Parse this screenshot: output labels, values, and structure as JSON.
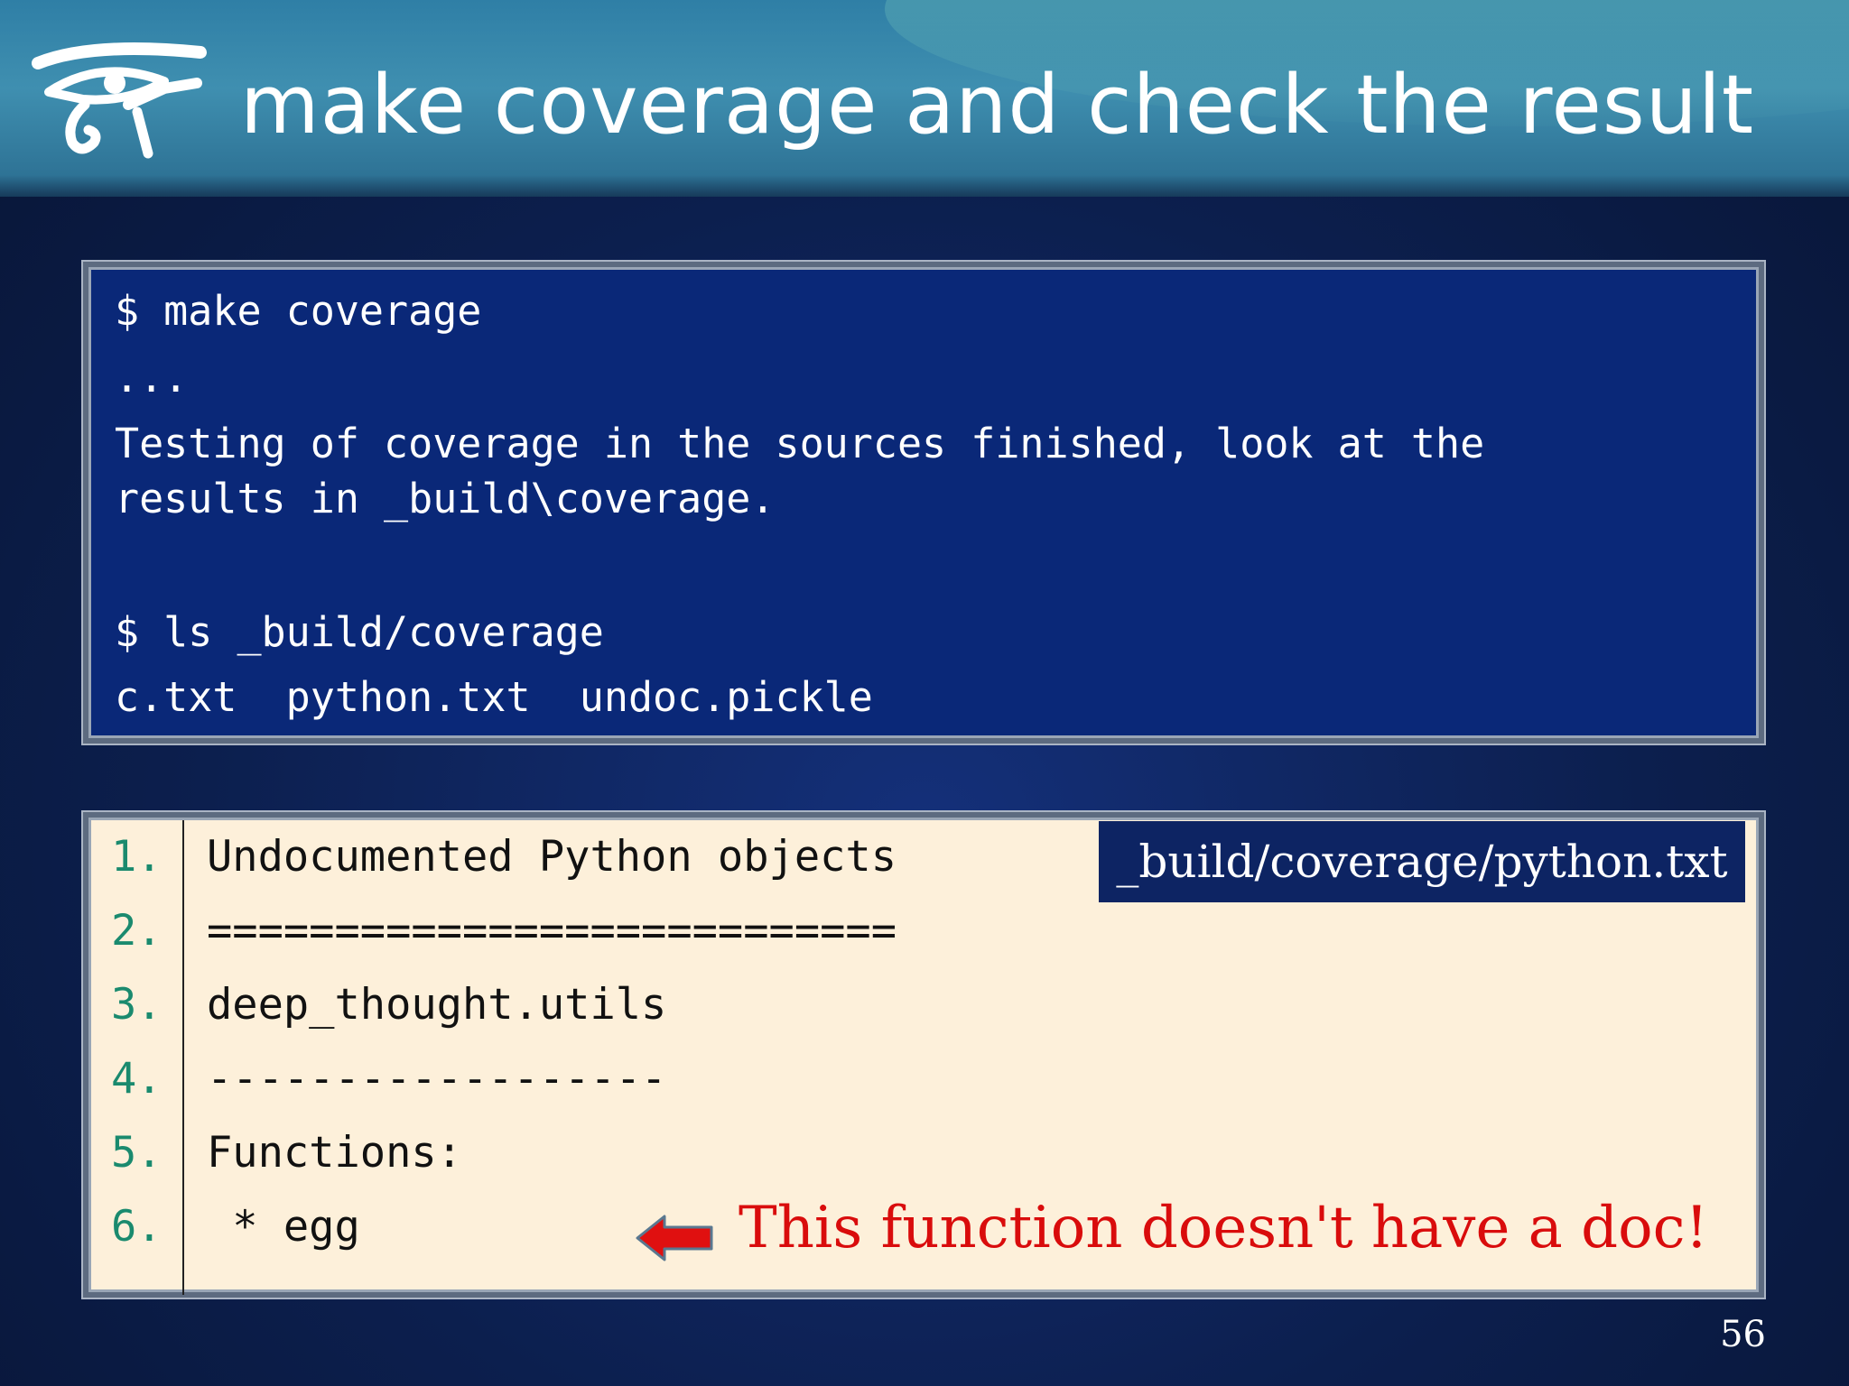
{
  "slide": {
    "title": "make coverage and check the result",
    "page_number": "56"
  },
  "logo": {
    "icon": "eye-of-horus-icon"
  },
  "terminal": {
    "lines": [
      "$ make coverage",
      "...",
      "Testing of coverage in the sources finished, look at the",
      "results in _build\\coverage.",
      "$ ls _build/coverage",
      "c.txt  python.txt  undoc.pickle"
    ]
  },
  "code_listing": {
    "file_label": "_build/coverage/python.txt",
    "rows": [
      {
        "num": "1.",
        "code": "Undocumented Python objects"
      },
      {
        "num": "2.",
        "code": "==========================="
      },
      {
        "num": "3.",
        "code": "deep_thought.utils"
      },
      {
        "num": "4.",
        "code": "------------------"
      },
      {
        "num": "5.",
        "code": "Functions:"
      },
      {
        "num": "6.",
        "code": " * egg"
      }
    ]
  },
  "annotation": {
    "text": "This function doesn't have a doc!",
    "arrow_icon": "left-arrow-icon",
    "color": "#d90c0c"
  }
}
